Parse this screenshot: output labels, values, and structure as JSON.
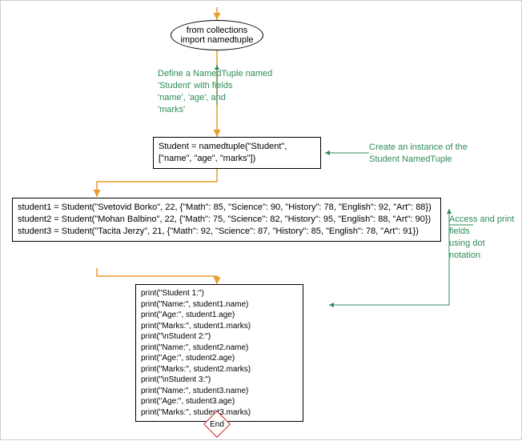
{
  "start": {
    "label": "from collections\nimport namedtuple"
  },
  "comments": {
    "c1": "Define a NamedTuple named\n'Student' with fields\n'name', 'age', and\n'marks'",
    "c2": "Create an instance of the\nStudent NamedTuple",
    "c3": "Access and print fields\nusing dot notation"
  },
  "boxes": {
    "define": "Student = namedtuple(\"Student\",\n[\"name\", \"age\", \"marks\"])",
    "instances": "student1 = Student(\"Svetovid Borko\", 22, {\"Math\": 85, \"Science\": 90, \"History\": 78, \"English\": 92, \"Art\": 88})\nstudent2 = Student(\"Mohan Balbino\", 22, {\"Math\": 75, \"Science\": 82, \"History\": 95, \"English\": 88, \"Art\": 90})\nstudent3 = Student(\"Tacita Jerzy\", 21, {\"Math\": 92, \"Science\": 87, \"History\": 85, \"English\": 78, \"Art\": 91})",
    "prints": "print(\"Student 1:\")\nprint(\"Name:\", student1.name)\nprint(\"Age:\", student1.age)\nprint(\"Marks:\", student1.marks)\nprint(\"\\nStudent 2:\")\nprint(\"Name:\", student2.name)\nprint(\"Age:\", student2.age)\nprint(\"Marks:\", student2.marks)\nprint(\"\\nStudent 3:\")\nprint(\"Name:\", student3.name)\nprint(\"Age:\", student3.age)\nprint(\"Marks:\", student3.marks)"
  },
  "end": {
    "label": "End"
  },
  "colors": {
    "arrow_main": "#e89c2c",
    "arrow_comment": "#2e8b57",
    "end_border": "#d02020"
  }
}
